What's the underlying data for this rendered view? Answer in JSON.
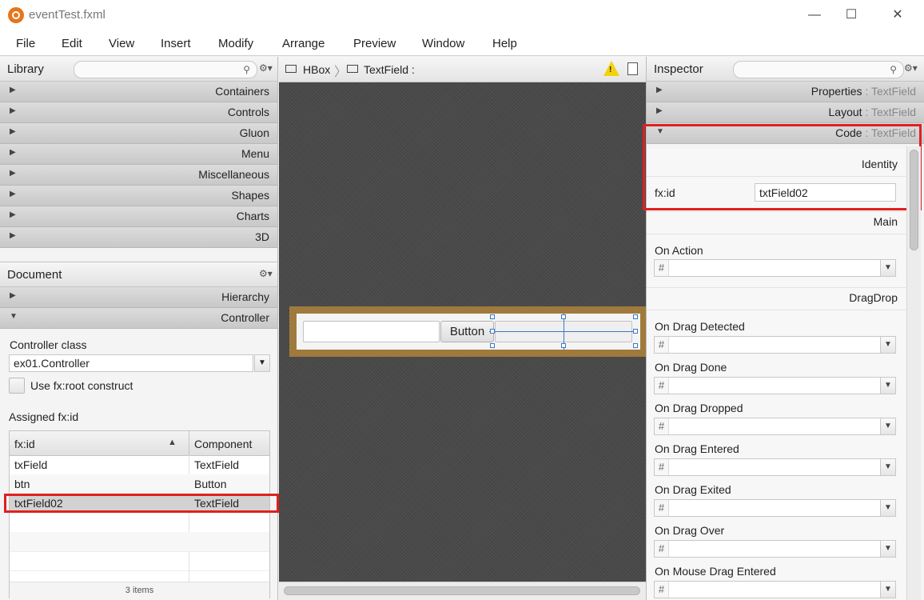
{
  "window": {
    "title": "eventTest.fxml",
    "controls": [
      "—",
      "☐",
      "✕"
    ]
  },
  "menu": [
    "File",
    "Edit",
    "View",
    "Insert",
    "Modify",
    "Arrange",
    "Preview",
    "Window",
    "Help"
  ],
  "library": {
    "title": "Library",
    "sections": [
      "Containers",
      "Controls",
      "Gluon",
      "Menu",
      "Miscellaneous",
      "Shapes",
      "Charts",
      "3D"
    ]
  },
  "document": {
    "title": "Document",
    "sections": [
      "Hierarchy",
      "Controller"
    ],
    "controller_class_label": "Controller class",
    "controller_class_value": "ex01.Controller",
    "root_construct_label": "Use fx:root construct",
    "assigned_label": "Assigned fx:id",
    "table": {
      "headers": [
        "fx:id",
        "Component"
      ],
      "sort_indicator": "▲",
      "rows": [
        {
          "id": "txField",
          "component": "TextField"
        },
        {
          "id": "btn",
          "component": "Button"
        },
        {
          "id": "txtField02",
          "component": "TextField"
        }
      ],
      "footer": "3 items"
    }
  },
  "breadcrumb": {
    "items": [
      "HBox",
      "TextField :"
    ],
    "warning_icon": "warning-icon",
    "doc_icon": "document-icon"
  },
  "canvas": {
    "button_label": "Button"
  },
  "inspector": {
    "title": "Inspector",
    "sections": [
      {
        "label": "Properties",
        "sub": "TextField"
      },
      {
        "label": "Layout",
        "sub": "TextField"
      },
      {
        "label": "Code",
        "sub": "TextField"
      }
    ],
    "identity_header": "Identity",
    "fxid_label": "fx:id",
    "fxid_value": "txtField02",
    "main_header": "Main",
    "on_action": "On Action",
    "dragdrop_header": "DragDrop",
    "events": [
      "On Drag Detected",
      "On Drag Done",
      "On Drag Dropped",
      "On Drag Entered",
      "On Drag Exited",
      "On Drag Over",
      "On Mouse Drag Entered"
    ],
    "hash": "#"
  },
  "colors": {
    "highlight": "#e02020",
    "hbox": "#a07a3c",
    "selection_handle": "#3c78c8"
  }
}
